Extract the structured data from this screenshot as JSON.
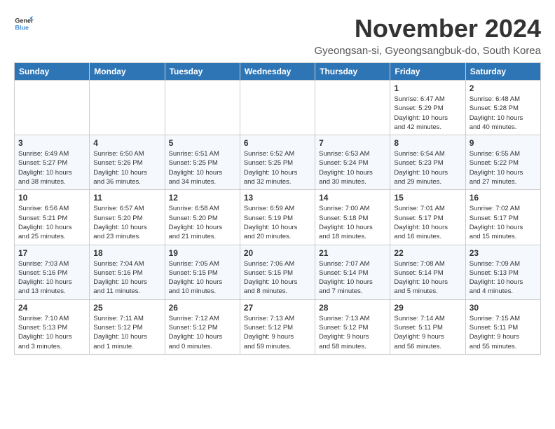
{
  "logo": {
    "line1": "General",
    "line2": "Blue"
  },
  "title": "November 2024",
  "subtitle": "Gyeongsan-si, Gyeongsangbuk-do, South Korea",
  "days_of_week": [
    "Sunday",
    "Monday",
    "Tuesday",
    "Wednesday",
    "Thursday",
    "Friday",
    "Saturday"
  ],
  "weeks": [
    [
      {
        "day": "",
        "info": ""
      },
      {
        "day": "",
        "info": ""
      },
      {
        "day": "",
        "info": ""
      },
      {
        "day": "",
        "info": ""
      },
      {
        "day": "",
        "info": ""
      },
      {
        "day": "1",
        "info": "Sunrise: 6:47 AM\nSunset: 5:29 PM\nDaylight: 10 hours\nand 42 minutes."
      },
      {
        "day": "2",
        "info": "Sunrise: 6:48 AM\nSunset: 5:28 PM\nDaylight: 10 hours\nand 40 minutes."
      }
    ],
    [
      {
        "day": "3",
        "info": "Sunrise: 6:49 AM\nSunset: 5:27 PM\nDaylight: 10 hours\nand 38 minutes."
      },
      {
        "day": "4",
        "info": "Sunrise: 6:50 AM\nSunset: 5:26 PM\nDaylight: 10 hours\nand 36 minutes."
      },
      {
        "day": "5",
        "info": "Sunrise: 6:51 AM\nSunset: 5:25 PM\nDaylight: 10 hours\nand 34 minutes."
      },
      {
        "day": "6",
        "info": "Sunrise: 6:52 AM\nSunset: 5:25 PM\nDaylight: 10 hours\nand 32 minutes."
      },
      {
        "day": "7",
        "info": "Sunrise: 6:53 AM\nSunset: 5:24 PM\nDaylight: 10 hours\nand 30 minutes."
      },
      {
        "day": "8",
        "info": "Sunrise: 6:54 AM\nSunset: 5:23 PM\nDaylight: 10 hours\nand 29 minutes."
      },
      {
        "day": "9",
        "info": "Sunrise: 6:55 AM\nSunset: 5:22 PM\nDaylight: 10 hours\nand 27 minutes."
      }
    ],
    [
      {
        "day": "10",
        "info": "Sunrise: 6:56 AM\nSunset: 5:21 PM\nDaylight: 10 hours\nand 25 minutes."
      },
      {
        "day": "11",
        "info": "Sunrise: 6:57 AM\nSunset: 5:20 PM\nDaylight: 10 hours\nand 23 minutes."
      },
      {
        "day": "12",
        "info": "Sunrise: 6:58 AM\nSunset: 5:20 PM\nDaylight: 10 hours\nand 21 minutes."
      },
      {
        "day": "13",
        "info": "Sunrise: 6:59 AM\nSunset: 5:19 PM\nDaylight: 10 hours\nand 20 minutes."
      },
      {
        "day": "14",
        "info": "Sunrise: 7:00 AM\nSunset: 5:18 PM\nDaylight: 10 hours\nand 18 minutes."
      },
      {
        "day": "15",
        "info": "Sunrise: 7:01 AM\nSunset: 5:17 PM\nDaylight: 10 hours\nand 16 minutes."
      },
      {
        "day": "16",
        "info": "Sunrise: 7:02 AM\nSunset: 5:17 PM\nDaylight: 10 hours\nand 15 minutes."
      }
    ],
    [
      {
        "day": "17",
        "info": "Sunrise: 7:03 AM\nSunset: 5:16 PM\nDaylight: 10 hours\nand 13 minutes."
      },
      {
        "day": "18",
        "info": "Sunrise: 7:04 AM\nSunset: 5:16 PM\nDaylight: 10 hours\nand 11 minutes."
      },
      {
        "day": "19",
        "info": "Sunrise: 7:05 AM\nSunset: 5:15 PM\nDaylight: 10 hours\nand 10 minutes."
      },
      {
        "day": "20",
        "info": "Sunrise: 7:06 AM\nSunset: 5:15 PM\nDaylight: 10 hours\nand 8 minutes."
      },
      {
        "day": "21",
        "info": "Sunrise: 7:07 AM\nSunset: 5:14 PM\nDaylight: 10 hours\nand 7 minutes."
      },
      {
        "day": "22",
        "info": "Sunrise: 7:08 AM\nSunset: 5:14 PM\nDaylight: 10 hours\nand 5 minutes."
      },
      {
        "day": "23",
        "info": "Sunrise: 7:09 AM\nSunset: 5:13 PM\nDaylight: 10 hours\nand 4 minutes."
      }
    ],
    [
      {
        "day": "24",
        "info": "Sunrise: 7:10 AM\nSunset: 5:13 PM\nDaylight: 10 hours\nand 3 minutes."
      },
      {
        "day": "25",
        "info": "Sunrise: 7:11 AM\nSunset: 5:12 PM\nDaylight: 10 hours\nand 1 minute."
      },
      {
        "day": "26",
        "info": "Sunrise: 7:12 AM\nSunset: 5:12 PM\nDaylight: 10 hours\nand 0 minutes."
      },
      {
        "day": "27",
        "info": "Sunrise: 7:13 AM\nSunset: 5:12 PM\nDaylight: 9 hours\nand 59 minutes."
      },
      {
        "day": "28",
        "info": "Sunrise: 7:13 AM\nSunset: 5:12 PM\nDaylight: 9 hours\nand 58 minutes."
      },
      {
        "day": "29",
        "info": "Sunrise: 7:14 AM\nSunset: 5:11 PM\nDaylight: 9 hours\nand 56 minutes."
      },
      {
        "day": "30",
        "info": "Sunrise: 7:15 AM\nSunset: 5:11 PM\nDaylight: 9 hours\nand 55 minutes."
      }
    ]
  ]
}
